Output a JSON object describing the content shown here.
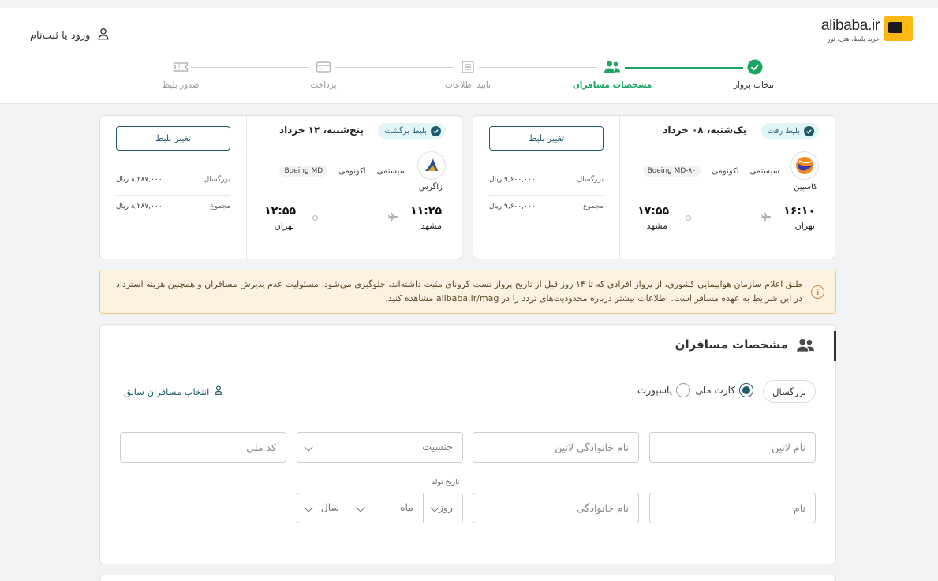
{
  "header": {
    "logo_text": "alibaba.ir",
    "logo_sub": "خرید بلیط، هتل، تور",
    "login_label": "ورود یا ثبت‌نام"
  },
  "stepper": {
    "steps": [
      {
        "label": "انتخاب پرواز",
        "state": "done",
        "icon": "check-circle-icon"
      },
      {
        "label": "مشخصات مسافران",
        "state": "active",
        "icon": "users-icon"
      },
      {
        "label": "تایید اطلاعات",
        "state": "pending",
        "icon": "list-icon"
      },
      {
        "label": "پرداخت",
        "state": "pending",
        "icon": "card-icon"
      },
      {
        "label": "صدور بلیط",
        "state": "pending",
        "icon": "ticket-icon"
      }
    ]
  },
  "outbound": {
    "badge": "بلیط رفت",
    "date": "یک‌شنبه، ۰۸ خرداد",
    "airline": "کاسپین",
    "class_type": "سیستمی",
    "cabin": "اکونومی",
    "aircraft": "Boeing MD-۸۰",
    "depart_time": "۱۶:۱۰",
    "depart_city": "تهران",
    "arrive_time": "۱۷:۵۵",
    "arrive_city": "مشهد",
    "change_label": "تغییر بلیط",
    "adult_label": "بزرگسال",
    "adult_price": "۹,۶۰۰,۰۰۰",
    "total_label": "مجموع",
    "total_price": "۹,۶۰۰,۰۰۰",
    "currency": "ریال"
  },
  "return": {
    "badge": "بلیط برگشت",
    "date": "پنج‌شنبه، ۱۲ خرداد",
    "airline": "زاگرس",
    "class_type": "سیستمی",
    "cabin": "اکونومی",
    "aircraft": "Boeing MD",
    "depart_time": "۱۱:۲۵",
    "depart_city": "مشهد",
    "arrive_time": "۱۲:۵۵",
    "arrive_city": "تهران",
    "change_label": "تغییر بلیط",
    "adult_label": "بزرگسال",
    "adult_price": "۸,۲۸۷,۰۰۰",
    "total_label": "مجموع",
    "total_price": "۸,۲۸۷,۰۰۰",
    "currency": "ریال"
  },
  "alert": {
    "line1": "طبق اعلام سازمان هواپیمایی کشوری، از پرواز افرادی که تا ۱۴ روز قبل از تاریخ پرواز تست کرونای مثبت داشته‌اند، جلوگیری می‌شود. مسئولیت عدم پذیرش مسافران و همچنین هزینه استرداد",
    "line2": "در این شرایط به عهده مسافر است. اطلاعات بیشتر درباره محدودیت‌های تردد را در alibaba.ir/mag مشاهده کنید."
  },
  "passengers": {
    "title": "مشخصات مسافران",
    "prev_link": "انتخاب مسافران سابق",
    "age_type": "بزرگسال",
    "id_option_national": "کارت ملی",
    "id_option_passport": "پاسپورت",
    "fields": {
      "latin_name": "نام لاتین",
      "latin_family": "نام خانوادگی لاتین",
      "gender": "جنسیت",
      "national_code": "کد ملی",
      "name": "نام",
      "family": "نام خانوادگی",
      "birth_label": "تاریخ تولد",
      "birth_day": "روز",
      "birth_month": "ماه",
      "birth_year": "سال"
    }
  },
  "colors": {
    "accent": "#1e5c6a",
    "success": "#1aa660",
    "alert_bg": "#fdf1e1",
    "logo_yellow": "#fdb713"
  }
}
